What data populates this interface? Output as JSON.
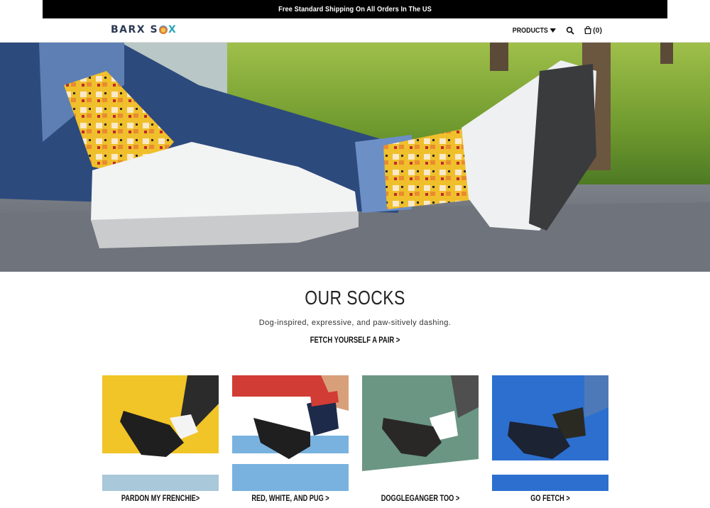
{
  "announcement": "Free Standard Shipping On All Orders In The US",
  "header": {
    "logo": {
      "part1": "BARX S",
      "part2": "X"
    },
    "nav": {
      "products_label": "PRODUCTS",
      "cart_label": "(0)"
    }
  },
  "hero": {
    "image": "legs-with-socks-and-white-sneakers-photo"
  },
  "section": {
    "title": "OUR SOCKS",
    "subtitle": "Dog-inspired, expressive, and paw-sitively dashing.",
    "cta": "FETCH YOURSELF A PAIR >"
  },
  "products": [
    {
      "label": "PARDON MY FRENCHIE>",
      "wall": "#f1c427",
      "stripe": "#ffffff",
      "floor": "#a9c8d9",
      "sock": "#f4f4f4"
    },
    {
      "label": "RED, WHITE, AND PUG >",
      "wall": "#ffffff",
      "stripe": "#79b2de",
      "floor": "#79b2de",
      "sock": "#1d2a4a"
    },
    {
      "label": "DOGGLEGANGER TOO >",
      "wall": "#6a9683",
      "stripe": "#ffffff",
      "floor": "#ffffff",
      "sock": "#ffffff"
    },
    {
      "label": "GO FETCH >",
      "wall": "#2c6fcf",
      "stripe": "#ffffff",
      "floor": "#2c6fcf",
      "sock": "#2a2a22"
    }
  ]
}
